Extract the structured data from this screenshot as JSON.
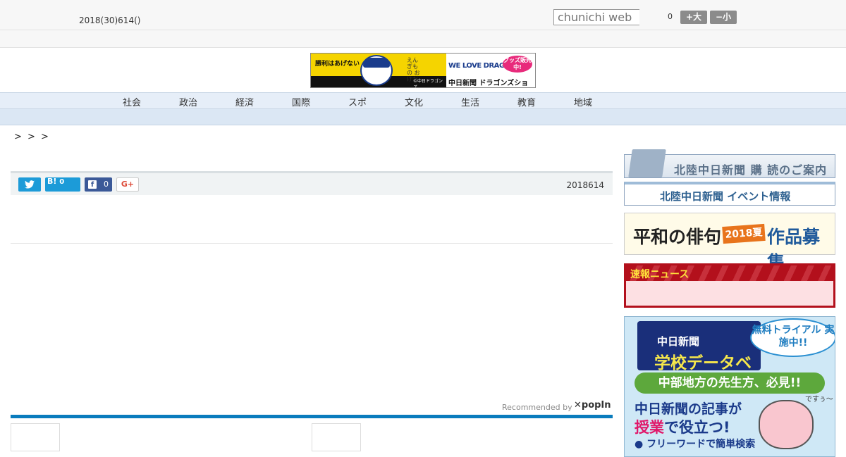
{
  "header": {
    "date": "2018(30)614()",
    "search_placeholder": "chunichi web",
    "counter": "0",
    "font_large": "+大",
    "font_small": "−小"
  },
  "banner": {
    "catch_left": "勝利はあげない",
    "catch_mid": "えんぎもの おけだ",
    "copyright": "©中日ドラゴンズ",
    "we_love": "WE LOVE DRAGONS",
    "shop": "中日新聞 ドラゴンズショップ",
    "goods": "グッズ販売中!"
  },
  "nav": {
    "items": [
      "社会",
      "政治",
      "経済",
      "国際",
      "スポ",
      "文化",
      "生活",
      "教育",
      "地域"
    ]
  },
  "breadcrumb": ">  >    >",
  "share": {
    "twitter_icon": "twitter-icon",
    "hatena_label": "B!",
    "hatena_count": "0",
    "facebook_label": "f",
    "facebook_count": "0",
    "gplus_label": "G+",
    "date": "2018614"
  },
  "recommend": {
    "label": "Recommended by",
    "brand": "✕popIn"
  },
  "sidebar": {
    "subscribe": "北陸中日新聞 購 読のご案内",
    "events": "北陸中日新聞 イベント情報",
    "haiku_left": "平和の俳句",
    "haiku_year": "2018夏",
    "haiku_right": "作品募集",
    "breaking_title": "速報ニュース",
    "school_logo_1": "中日新聞",
    "school_logo_2": "学校データベース",
    "school_trial": "無料トライアル 実施中!!",
    "school_green": "中部地方の先生方、必見!!",
    "school_m1": "中日新聞の記事が",
    "school_m2_a": "授業",
    "school_m2_b": "で役立つ!",
    "school_m3": "● フリーワードで簡単検索",
    "school_desu": "ですぅ〜"
  }
}
